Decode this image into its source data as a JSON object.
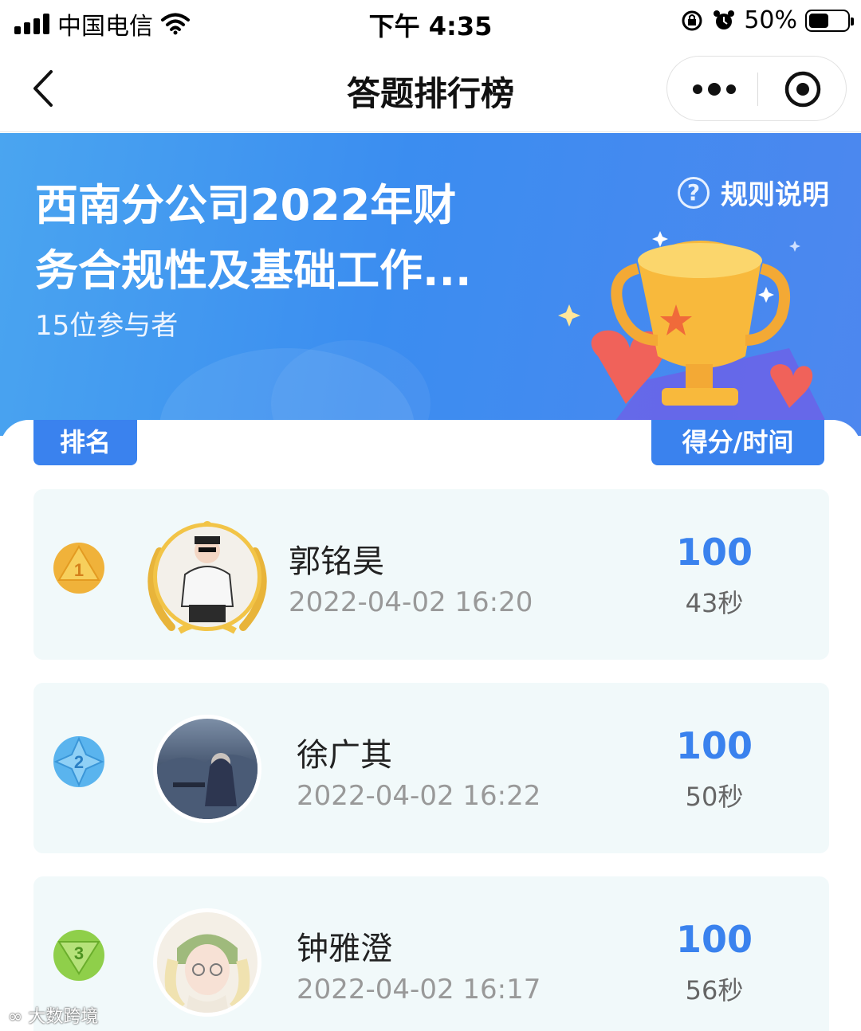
{
  "status_bar": {
    "carrier": "中国电信",
    "time": "下午 4:35",
    "battery_percent": "50%"
  },
  "nav": {
    "title": "答题排行榜"
  },
  "banner": {
    "title_line1": "西南分公司2022年财",
    "title_line2": "务合规性及基础工作...",
    "participants": "15位参与者",
    "rules_label": "规则说明"
  },
  "table": {
    "rank_header": "排名",
    "score_header": "得分/时间",
    "rows": [
      {
        "rank": "1",
        "name": "郭铭昊",
        "datetime": "2022-04-02 16:20",
        "score": "100",
        "duration": "43秒",
        "medal_color": "#f0b23a"
      },
      {
        "rank": "2",
        "name": "徐广其",
        "datetime": "2022-04-02 16:22",
        "score": "100",
        "duration": "50秒",
        "medal_color": "#5ab4ee"
      },
      {
        "rank": "3",
        "name": "钟雅澄",
        "datetime": "2022-04-02 16:17",
        "score": "100",
        "duration": "56秒",
        "medal_color": "#8fcf4a"
      }
    ]
  },
  "watermark": "大数跨境",
  "colors": {
    "accent": "#3a82ee",
    "banner": "#3b8df0",
    "row_bg": "#f1f9fa"
  }
}
